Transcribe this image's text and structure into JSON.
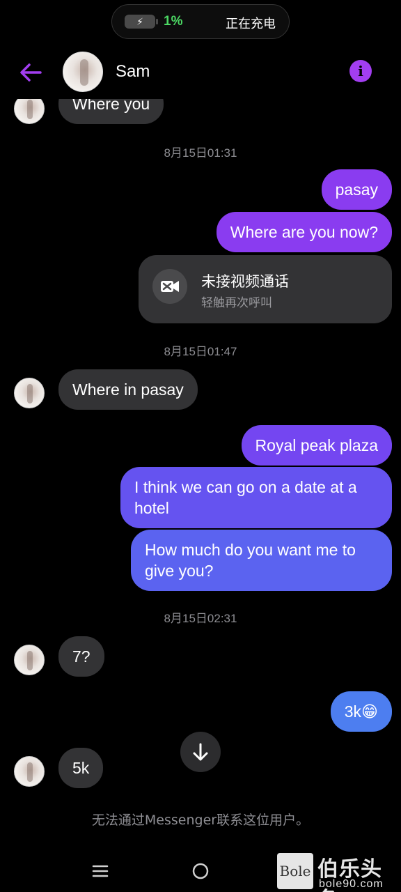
{
  "status": {
    "battery_percent": "1%",
    "charging_text": "正在充电"
  },
  "header": {
    "contact_name": "Sam"
  },
  "messages": {
    "m0": "Where you",
    "ts1": "8月15日01:31",
    "m1": "pasay",
    "m2": "Where are you now?",
    "call": {
      "title": "未接视频通话",
      "subtitle": "轻触再次呼叫"
    },
    "ts2": "8月15日01:47",
    "m3": "Where in pasay",
    "m4": "Royal peak plaza",
    "m5": "I think we can go on a date at a\nhotel",
    "m6": "How much do you want me to\ngive you?",
    "ts3": "8月15日02:31",
    "m7": "7?",
    "m8": "3k😁",
    "m9": "5k"
  },
  "footer": {
    "note": "无法通过Messenger联系这位用户。"
  },
  "watermark": {
    "logo": "Bole",
    "title": "伯乐头条",
    "url": "bole90.com"
  },
  "colors": {
    "accent": "#a23ef0",
    "incoming": "#333335",
    "outgoing_purple": "#8a3cf0",
    "outgoing_blue": "#5b74f0",
    "background": "#000000"
  }
}
